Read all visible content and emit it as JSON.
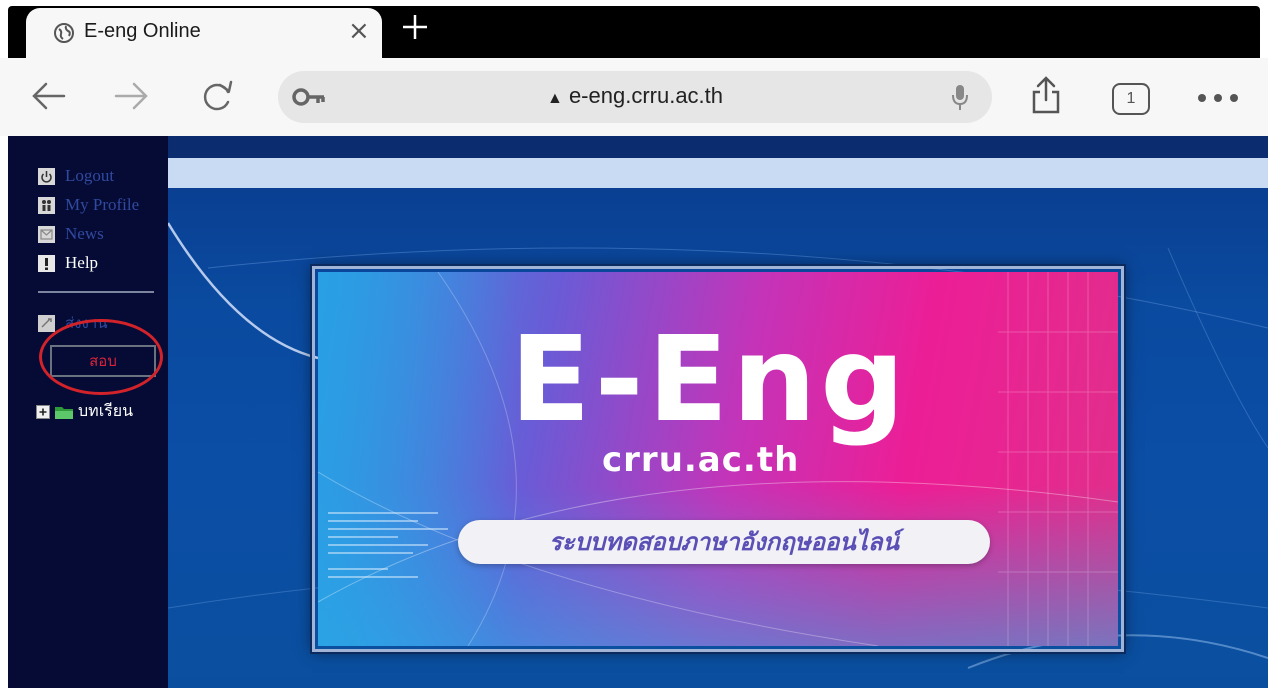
{
  "browser": {
    "tab": {
      "title": "E-eng Online",
      "close_glyph": "×"
    },
    "new_tab_glyph": "+",
    "address": {
      "url": "e-eng.crru.ac.th",
      "warning_glyph": "▲"
    },
    "tabs_count": "1"
  },
  "sidebar": {
    "items": [
      {
        "label": "Logout",
        "icon": "power-icon"
      },
      {
        "label": "My Profile",
        "icon": "profile-icon"
      },
      {
        "label": "News",
        "icon": "news-icon"
      },
      {
        "label": "Help",
        "icon": "help-icon"
      }
    ],
    "assignment_label": "ส่งงาน",
    "exam_button": "สอบ",
    "lessons_label": "บทเรียน"
  },
  "banner": {
    "title": "E-Eng",
    "subtitle": "crru.ac.th",
    "tagline": "ระบบทดสอบภาษาอังกฤษออนไลน์"
  },
  "colors": {
    "sidebar_bg": "#050b35",
    "menu_link": "#31499f",
    "exam_text": "#d9233a",
    "highlight_circle": "#d2232a",
    "banner_pink": "#ec1e96",
    "banner_blue": "#2a9fe0"
  }
}
